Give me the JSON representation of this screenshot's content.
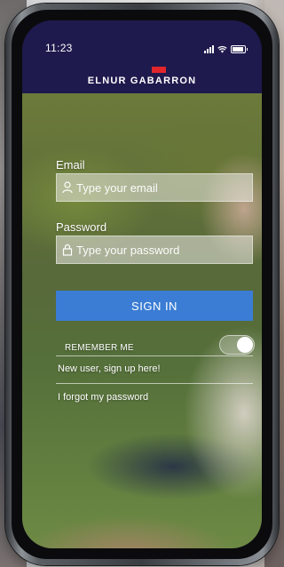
{
  "status": {
    "time": "11:23"
  },
  "brand": {
    "name": "ELNUR GABARRON",
    "accent_color": "#e0262b",
    "header_color": "#1f1a4d"
  },
  "form": {
    "email_label": "Email",
    "email_placeholder": "Type your email",
    "password_label": "Password",
    "password_placeholder": "Type your password",
    "signin_label": "SIGN IN",
    "signin_color": "#3b7dd4",
    "remember_label": "REMEMBER ME",
    "remember_on": true
  },
  "links": {
    "signup": "New user, sign up here!",
    "forgot": "I forgot my password"
  },
  "icons": [
    "user-icon",
    "lock-icon",
    "signal-icon",
    "wifi-icon",
    "battery-icon"
  ]
}
